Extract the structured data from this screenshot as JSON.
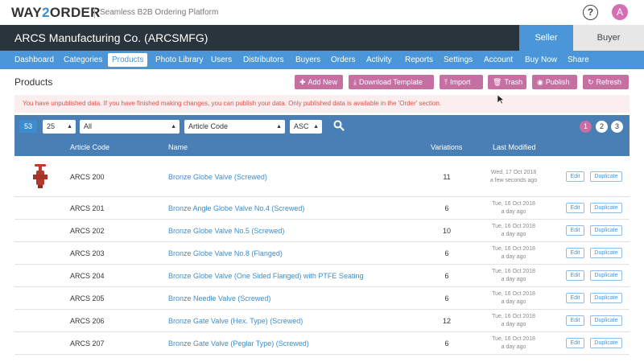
{
  "app": {
    "logo_prefix": "WAY",
    "logo_two": "2",
    "logo_suffix": "ORDER",
    "tagline": "Seamless B2B Ordering Platform",
    "help_label": "?",
    "avatar_initial": "A"
  },
  "company": {
    "name": "ARCS Manufacturing Co. (ARCSMFG)"
  },
  "roles": {
    "seller": "Seller",
    "buyer": "Buyer"
  },
  "nav": [
    "Dashboard",
    "Categories",
    "Products",
    "Photo Library",
    "Users",
    "Distributors",
    "Buyers",
    "Orders",
    "Activity",
    "Reports",
    "Settings",
    "Account",
    "Buy Now",
    "Share"
  ],
  "page": {
    "title": "Products"
  },
  "actions": {
    "add_new": "Add New",
    "download_template": "Download Template",
    "import": "Import",
    "trash": "Trash",
    "publish": "Publish",
    "refresh": "Refresh"
  },
  "alert": {
    "text": "You have unpublished data. If you have finished making changes, you can publish your data. Only published data is available in the 'Order' section."
  },
  "filter": {
    "count": "53",
    "page_size": "25",
    "category": "All",
    "sort_field": "Article Code",
    "sort_dir": "ASC",
    "pages": [
      "1",
      "2",
      "3"
    ],
    "current_page": "1"
  },
  "table": {
    "columns": {
      "code": "Article Code",
      "name": "Name",
      "variations": "Variations",
      "modified": "Last Modified"
    },
    "edit_label": "Edit",
    "duplicate_label": "Duplicate",
    "rows": [
      {
        "code": "ARCS 200",
        "name": "Bronze Globe Valve (Screwed)",
        "variations": "11",
        "date": "Wed, 17 Oct 2018",
        "ago": "a few seconds ago"
      },
      {
        "code": "ARCS 201",
        "name": "Bronze Angle Globe Valve No.4 (Screwed)",
        "variations": "6",
        "date": "Tue, 16 Oct 2018",
        "ago": "a day ago"
      },
      {
        "code": "ARCS 202",
        "name": "Bronze Globe Valve No.5 (Screwed)",
        "variations": "10",
        "date": "Tue, 16 Oct 2018",
        "ago": "a day ago"
      },
      {
        "code": "ARCS 203",
        "name": "Bronze Globe Valve No.8 (Flanged)",
        "variations": "6",
        "date": "Tue, 16 Oct 2018",
        "ago": "a day ago"
      },
      {
        "code": "ARCS 204",
        "name": "Bronze Globe Valve (One Sided Flanged) with PTFE Seating",
        "variations": "6",
        "date": "Tue, 16 Oct 2018",
        "ago": "a day ago"
      },
      {
        "code": "ARCS 205",
        "name": "Bronze Needle Valve (Screwed)",
        "variations": "6",
        "date": "Tue, 16 Oct 2018",
        "ago": "a day ago"
      },
      {
        "code": "ARCS 206",
        "name": "Bronze Gate Valve (Hex. Type) (Screwed)",
        "variations": "12",
        "date": "Tue, 16 Oct 2018",
        "ago": "a day ago"
      },
      {
        "code": "ARCS 207",
        "name": "Bronze Gate Valve (Peglar Type) (Screwed)",
        "variations": "6",
        "date": "Tue, 16 Oct 2018",
        "ago": "a day ago"
      }
    ]
  },
  "colors": {
    "brand": "#4a96d8",
    "accent": "#c66fa3",
    "dark": "#29343d",
    "filter_bar": "#4a7fb5",
    "alert_text": "#d9534f"
  }
}
